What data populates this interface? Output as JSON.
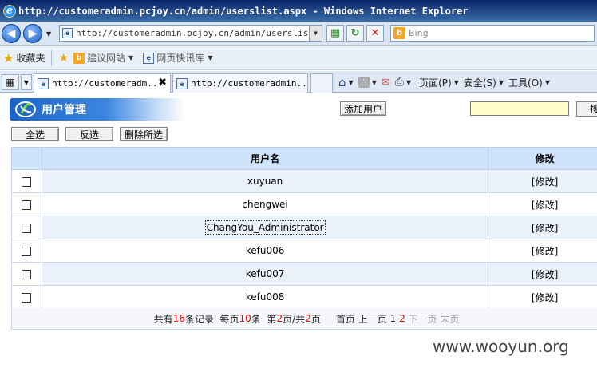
{
  "window": {
    "title": "http://customeradmin.pcjoy.cn/admin/userslist.aspx - Windows Internet Explorer"
  },
  "browser": {
    "address": "http://customeradmin.pcjoy.cn/admin/userslist.as",
    "search_placeholder": "Bing",
    "favorites_label": "收藏夹",
    "fav_items": [
      {
        "label": "建议网站"
      },
      {
        "label": "网页快讯库"
      }
    ],
    "tabs": [
      {
        "label": "http://customeradm...",
        "active": true
      },
      {
        "label": "http://customeradmin..."
      }
    ],
    "commands": {
      "page": "页面(P)",
      "safety": "安全(S)",
      "tools": "工具(O)"
    }
  },
  "page": {
    "header_title": "用户管理",
    "add_user": "添加用户",
    "search_button": "搜",
    "select_all": "全选",
    "invert": "反选",
    "delete_selected": "删除所选",
    "columns": {
      "username": "用户名",
      "edit": "修改"
    },
    "edit_link": "[修改]",
    "users": [
      {
        "name": "xuyuan"
      },
      {
        "name": "chengwei"
      },
      {
        "name": "ChangYou_Administrator"
      },
      {
        "name": "kefu006"
      },
      {
        "name": "kefu007"
      },
      {
        "name": "kefu008"
      }
    ],
    "pager": {
      "prefix": "共有",
      "total": "16",
      "records": "条记录",
      "per_page_prefix": "每页",
      "per_page": "10",
      "per_page_suffix": "条",
      "page_prefix": "第",
      "current": "2",
      "page_mid": "页/共",
      "pages": "2",
      "page_suffix": "页",
      "first": "首页",
      "prev": "上一页",
      "p1": "1",
      "p2": "2",
      "next": "下一页",
      "last": "末页"
    }
  },
  "watermark": "www.wooyun.org"
}
